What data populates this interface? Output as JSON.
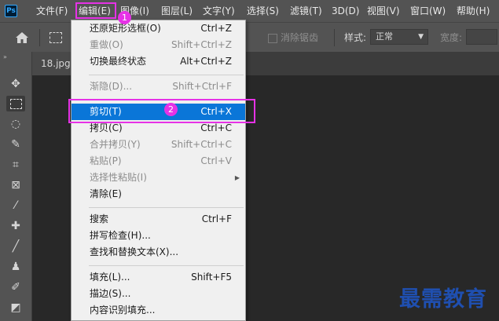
{
  "app": {
    "logo": "Ps"
  },
  "menubar": {
    "items": [
      {
        "label": "文件(F)"
      },
      {
        "label": "编辑(E)"
      },
      {
        "label": "图像(I)"
      },
      {
        "label": "图层(L)"
      },
      {
        "label": "文字(Y)"
      },
      {
        "label": "选择(S)"
      },
      {
        "label": "滤镜(T)"
      },
      {
        "label": "3D(D)"
      },
      {
        "label": "视图(V)"
      },
      {
        "label": "窗口(W)"
      },
      {
        "label": "帮助(H)"
      }
    ]
  },
  "options_bar": {
    "home_icon": "home-icon",
    "marquee_icon": "rect-marquee-icon",
    "antialias_label": "消除锯齿",
    "style_label": "样式:",
    "style_value": "正常",
    "width_label": "宽度:"
  },
  "document": {
    "tab_label": "18.jpg @"
  },
  "toolbar": {
    "tools": [
      "move-icon",
      "rect-marquee-icon",
      "lasso-icon",
      "quick-select-icon",
      "crop-icon",
      "frame-icon",
      "eyedropper-icon",
      "healing-brush-icon",
      "brush-icon",
      "clone-stamp-icon",
      "history-brush-icon",
      "eraser-icon"
    ]
  },
  "edit_menu": {
    "items": [
      {
        "label": "还原矩形选框(O)",
        "shortcut": "Ctrl+Z",
        "state": "enabled"
      },
      {
        "label": "重做(O)",
        "shortcut": "Shift+Ctrl+Z",
        "state": "disabled"
      },
      {
        "label": "切换最终状态",
        "shortcut": "Alt+Ctrl+Z",
        "state": "enabled"
      },
      {
        "label": "渐隐(D)...",
        "shortcut": "Shift+Ctrl+F",
        "state": "disabled"
      },
      {
        "label": "剪切(T)",
        "shortcut": "Ctrl+X",
        "state": "highlighted"
      },
      {
        "label": "拷贝(C)",
        "shortcut": "Ctrl+C",
        "state": "enabled"
      },
      {
        "label": "合并拷贝(Y)",
        "shortcut": "Shift+Ctrl+C",
        "state": "disabled"
      },
      {
        "label": "粘贴(P)",
        "shortcut": "Ctrl+V",
        "state": "disabled"
      },
      {
        "label": "选择性粘贴(I)",
        "shortcut": "",
        "state": "disabled"
      },
      {
        "label": "清除(E)",
        "shortcut": "",
        "state": "enabled"
      },
      {
        "label": "搜索",
        "shortcut": "Ctrl+F",
        "state": "enabled"
      },
      {
        "label": "拼写检查(H)...",
        "shortcut": "",
        "state": "enabled"
      },
      {
        "label": "查找和替换文本(X)...",
        "shortcut": "",
        "state": "enabled"
      },
      {
        "label": "填充(L)...",
        "shortcut": "Shift+F5",
        "state": "enabled"
      },
      {
        "label": "描边(S)...",
        "shortcut": "",
        "state": "enabled"
      },
      {
        "label": "内容识别填充...",
        "shortcut": "",
        "state": "enabled"
      }
    ]
  },
  "annotations": {
    "step1": "1",
    "step2": "2",
    "highlight_color": "#e632e6"
  },
  "watermark": "最需教育"
}
